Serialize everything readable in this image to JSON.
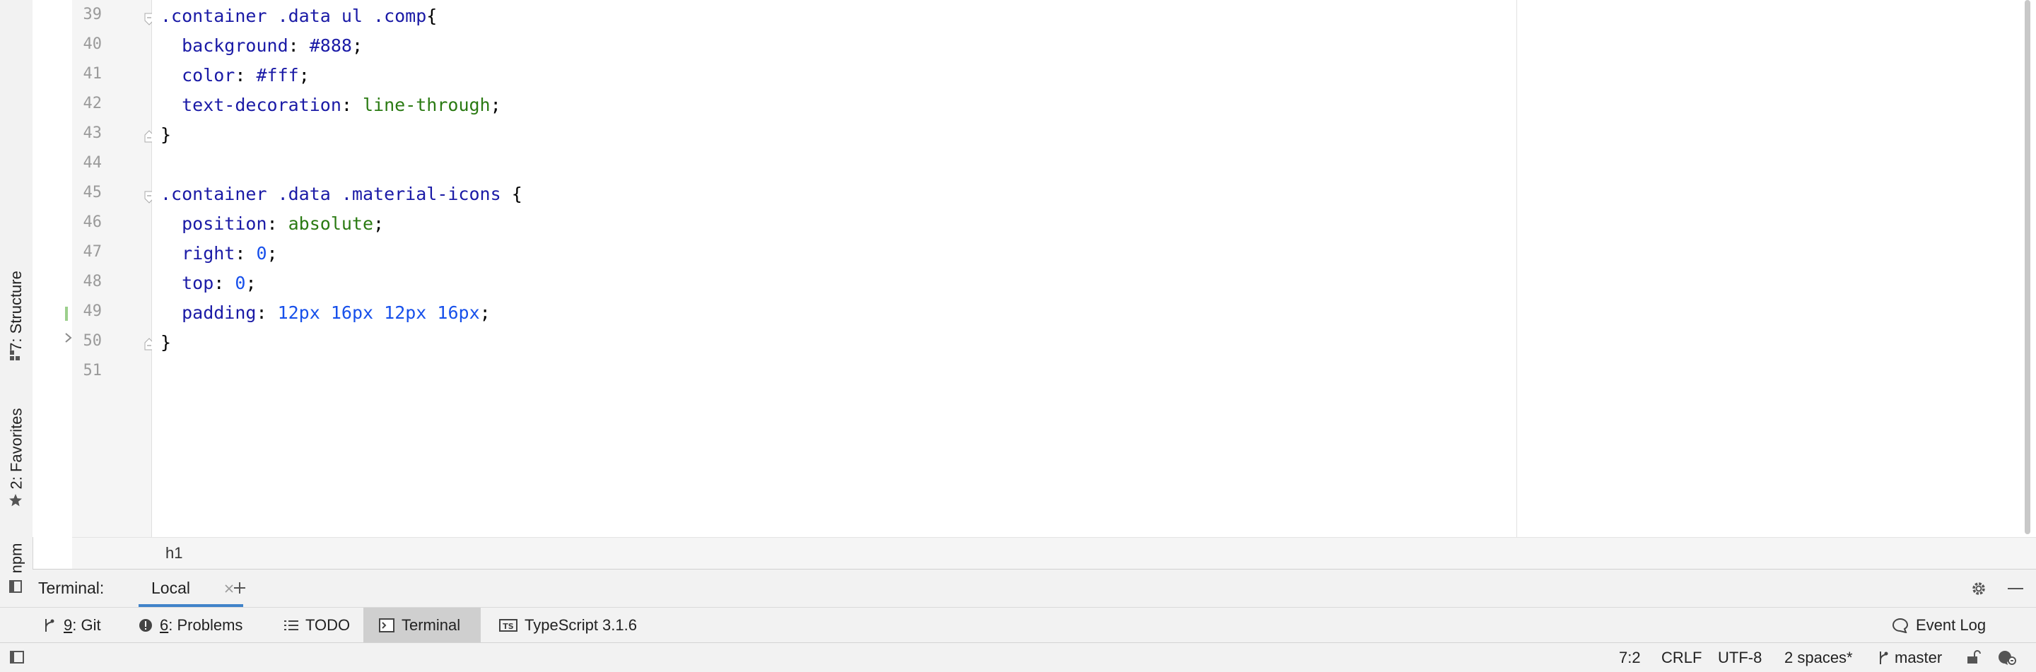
{
  "left_strip": {
    "structure_label": "7: Structure",
    "favorites_label": "2: Favorites",
    "npm_label": "npm"
  },
  "editor": {
    "line_numbers": [
      "39",
      "40",
      "41",
      "42",
      "43",
      "44",
      "45",
      "46",
      "47",
      "48",
      "49",
      "50",
      "51"
    ],
    "lines": [
      [
        {
          "t": ".container .data ul .comp",
          "c": "sel"
        },
        {
          "t": "{",
          "c": "punc"
        }
      ],
      [
        {
          "t": "  background",
          "c": "prop"
        },
        {
          "t": ": ",
          "c": "punc"
        },
        {
          "t": "#888",
          "c": "val-color"
        },
        {
          "t": ";",
          "c": "punc"
        }
      ],
      [
        {
          "t": "  color",
          "c": "prop"
        },
        {
          "t": ": ",
          "c": "punc"
        },
        {
          "t": "#fff",
          "c": "val-color"
        },
        {
          "t": ";",
          "c": "punc"
        }
      ],
      [
        {
          "t": "  text-decoration",
          "c": "prop"
        },
        {
          "t": ": ",
          "c": "punc"
        },
        {
          "t": "line-through",
          "c": "val-id"
        },
        {
          "t": ";",
          "c": "punc"
        }
      ],
      [
        {
          "t": "}",
          "c": "punc"
        }
      ],
      [],
      [
        {
          "t": ".container .data .material-icons ",
          "c": "sel"
        },
        {
          "t": "{",
          "c": "punc"
        }
      ],
      [
        {
          "t": "  position",
          "c": "prop"
        },
        {
          "t": ": ",
          "c": "punc"
        },
        {
          "t": "absolute",
          "c": "val-id"
        },
        {
          "t": ";",
          "c": "punc"
        }
      ],
      [
        {
          "t": "  right",
          "c": "prop"
        },
        {
          "t": ": ",
          "c": "punc"
        },
        {
          "t": "0",
          "c": "val-num"
        },
        {
          "t": ";",
          "c": "punc"
        }
      ],
      [
        {
          "t": "  top",
          "c": "prop"
        },
        {
          "t": ": ",
          "c": "punc"
        },
        {
          "t": "0",
          "c": "val-num"
        },
        {
          "t": ";",
          "c": "punc"
        }
      ],
      [
        {
          "t": "  padding",
          "c": "prop"
        },
        {
          "t": ": ",
          "c": "punc"
        },
        {
          "t": "12px",
          "c": "val-num"
        },
        {
          "t": " ",
          "c": "punc"
        },
        {
          "t": "16px",
          "c": "val-num"
        },
        {
          "t": " ",
          "c": "punc"
        },
        {
          "t": "12px",
          "c": "val-num"
        },
        {
          "t": " ",
          "c": "punc"
        },
        {
          "t": "16px",
          "c": "val-num"
        },
        {
          "t": ";",
          "c": "punc"
        }
      ],
      [
        {
          "t": "}",
          "c": "punc"
        }
      ],
      []
    ],
    "swatch_colors": [
      "#888888",
      "#ffffff"
    ]
  },
  "breadcrumb": {
    "path": "h1"
  },
  "terminal": {
    "label": "Terminal:",
    "tab_local": "Local",
    "add_tooltip": "+"
  },
  "toolbar": {
    "git_num": "9",
    "git_label": ": Git",
    "problems_num": "6",
    "problems_label": ": Problems",
    "todo_label": "TODO",
    "terminal_label": "Terminal",
    "ts_label": "TypeScript 3.1.6",
    "event_log_label": "Event Log"
  },
  "status": {
    "position": "7:2",
    "line_sep": "CRLF",
    "encoding": "UTF-8",
    "indent": "2 spaces*",
    "branch": "master"
  }
}
